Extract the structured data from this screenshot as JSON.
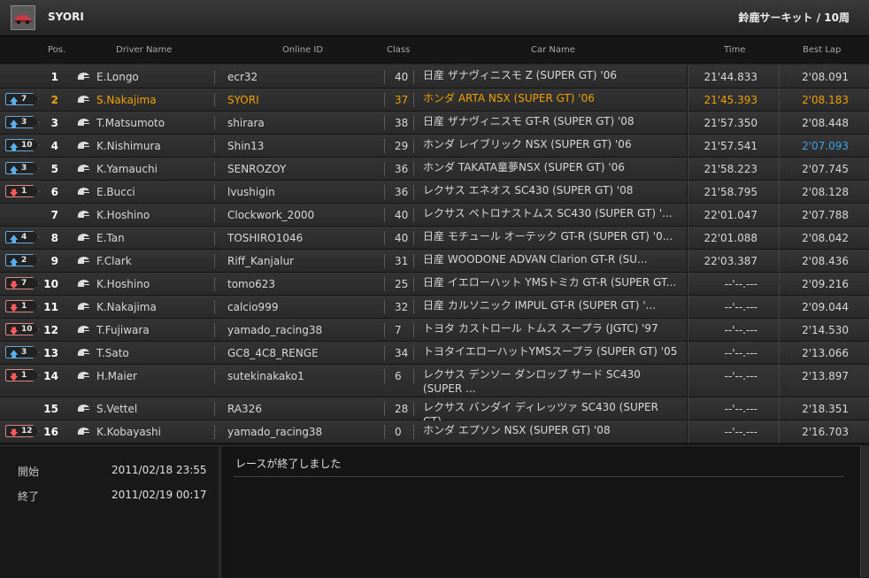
{
  "header": {
    "user_name": "SYORI",
    "race_info": "鈴鹿サーキット / 10周"
  },
  "columns": {
    "pos": "Pos.",
    "driver": "Driver Name",
    "online_id": "Online ID",
    "class": "Class",
    "car": "Car Name",
    "time": "Time",
    "best_lap": "Best Lap"
  },
  "rows": [
    {
      "pos": "1",
      "change": "",
      "dir": "",
      "driver": "E.Longo",
      "online_id": "ecr32",
      "class": "40",
      "car": "日産 ザナヴィニスモ Z (SUPER GT) '06",
      "time": "21'44.833",
      "best": "2'08.091"
    },
    {
      "pos": "2",
      "change": "7",
      "dir": "up",
      "driver": "S.Nakajima",
      "online_id": "SYORI",
      "class": "37",
      "car": "ホンダ ARTA NSX (SUPER GT) '06",
      "time": "21'45.393",
      "best": "2'08.183"
    },
    {
      "pos": "3",
      "change": "3",
      "dir": "up",
      "driver": "T.Matsumoto",
      "online_id": "shirara",
      "class": "38",
      "car": "日産 ザナヴィニスモ GT-R (SUPER GT) '08",
      "time": "21'57.350",
      "best": "2'08.448"
    },
    {
      "pos": "4",
      "change": "10",
      "dir": "up",
      "driver": "K.Nishimura",
      "online_id": "Shin13",
      "class": "29",
      "car": "ホンダ レイブリック NSX (SUPER GT) '06",
      "time": "21'57.541",
      "best": "2'07.093"
    },
    {
      "pos": "5",
      "change": "3",
      "dir": "up",
      "driver": "K.Yamauchi",
      "online_id": "SENROZOY",
      "class": "36",
      "car": "ホンダ TAKATA童夢NSX (SUPER GT) '06",
      "time": "21'58.223",
      "best": "2'07.745"
    },
    {
      "pos": "6",
      "change": "1",
      "dir": "down",
      "driver": "E.Bucci",
      "online_id": "lvushigin",
      "class": "36",
      "car": "レクサス エネオス SC430 (SUPER GT) '08",
      "time": "21'58.795",
      "best": "2'08.128"
    },
    {
      "pos": "7",
      "change": "",
      "dir": "",
      "driver": "K.Hoshino",
      "online_id": "Clockwork_2000",
      "class": "40",
      "car": "レクサス ペトロナストムス SC430 (SUPER GT) '...",
      "time": "22'01.047",
      "best": "2'07.788"
    },
    {
      "pos": "8",
      "change": "4",
      "dir": "up",
      "driver": "E.Tan",
      "online_id": "TOSHIRO1046",
      "class": "40",
      "car": "日産 モチュール オーテック GT-R (SUPER GT) '0...",
      "time": "22'01.088",
      "best": "2'08.042"
    },
    {
      "pos": "9",
      "change": "2",
      "dir": "up",
      "driver": "F.Clark",
      "online_id": "Riff_Kanjalur",
      "class": "31",
      "car": "日産 WOODONE ADVAN Clarion GT-R (SU...",
      "time": "22'03.387",
      "best": "2'08.436"
    },
    {
      "pos": "10",
      "change": "7",
      "dir": "down",
      "driver": "K.Hoshino",
      "online_id": "tomo623",
      "class": "25",
      "car": "日産 イエローハット YMSトミカ GT-R (SUPER GT...",
      "time": "--'--.---",
      "best": "2'09.216"
    },
    {
      "pos": "11",
      "change": "1",
      "dir": "down",
      "driver": "K.Nakajima",
      "online_id": "calcio999",
      "class": "32",
      "car": "日産 カルソニック IMPUL GT-R (SUPER GT) '...",
      "time": "--'--.---",
      "best": "2'09.044"
    },
    {
      "pos": "12",
      "change": "10",
      "dir": "down",
      "driver": "T.Fujiwara",
      "online_id": "yamado_racing38",
      "class": "7",
      "car": "トヨタ カストロール トムス スープラ (JGTC) '97",
      "time": "--'--.---",
      "best": "2'14.530"
    },
    {
      "pos": "13",
      "change": "3",
      "dir": "up",
      "driver": "T.Sato",
      "online_id": "GC8_4C8_RENGE",
      "class": "34",
      "car": "トヨタイエローハットYMSスープラ (SUPER GT) '05",
      "time": "--'--.---",
      "best": "2'13.066"
    },
    {
      "pos": "14",
      "change": "1",
      "dir": "down",
      "driver": "H.Maier",
      "online_id": "sutekinakako1",
      "class": "6",
      "car": "レクサス デンソー ダンロップ サード SC430 (SUPER ...",
      "time": "--'--.---",
      "best": "2'13.897"
    },
    {
      "pos": "15",
      "change": "",
      "dir": "",
      "driver": "S.Vettel",
      "online_id": "RA326",
      "class": "28",
      "car": "レクサス バンダイ ディレッツァ SC430 (SUPER GT)...",
      "time": "--'--.---",
      "best": "2'18.351"
    },
    {
      "pos": "16",
      "change": "12",
      "dir": "down",
      "driver": "K.Kobayashi",
      "online_id": "yamado_racing38",
      "class": "0",
      "car": "ホンダ エプソン NSX (SUPER GT) '08",
      "time": "--'--.---",
      "best": "2'16.703"
    }
  ],
  "highlight_row": 1,
  "best_overall_row": 3,
  "colors": {
    "player": "#f0a000",
    "best_lap": "#3ea2e8",
    "up": "#58b0f0",
    "down": "#ff5a5a"
  },
  "info": {
    "start_label": "開始",
    "start_value": "2011/02/18 23:55",
    "end_label": "終了",
    "end_value": "2011/02/19 00:17"
  },
  "message": "レースが終了しました"
}
